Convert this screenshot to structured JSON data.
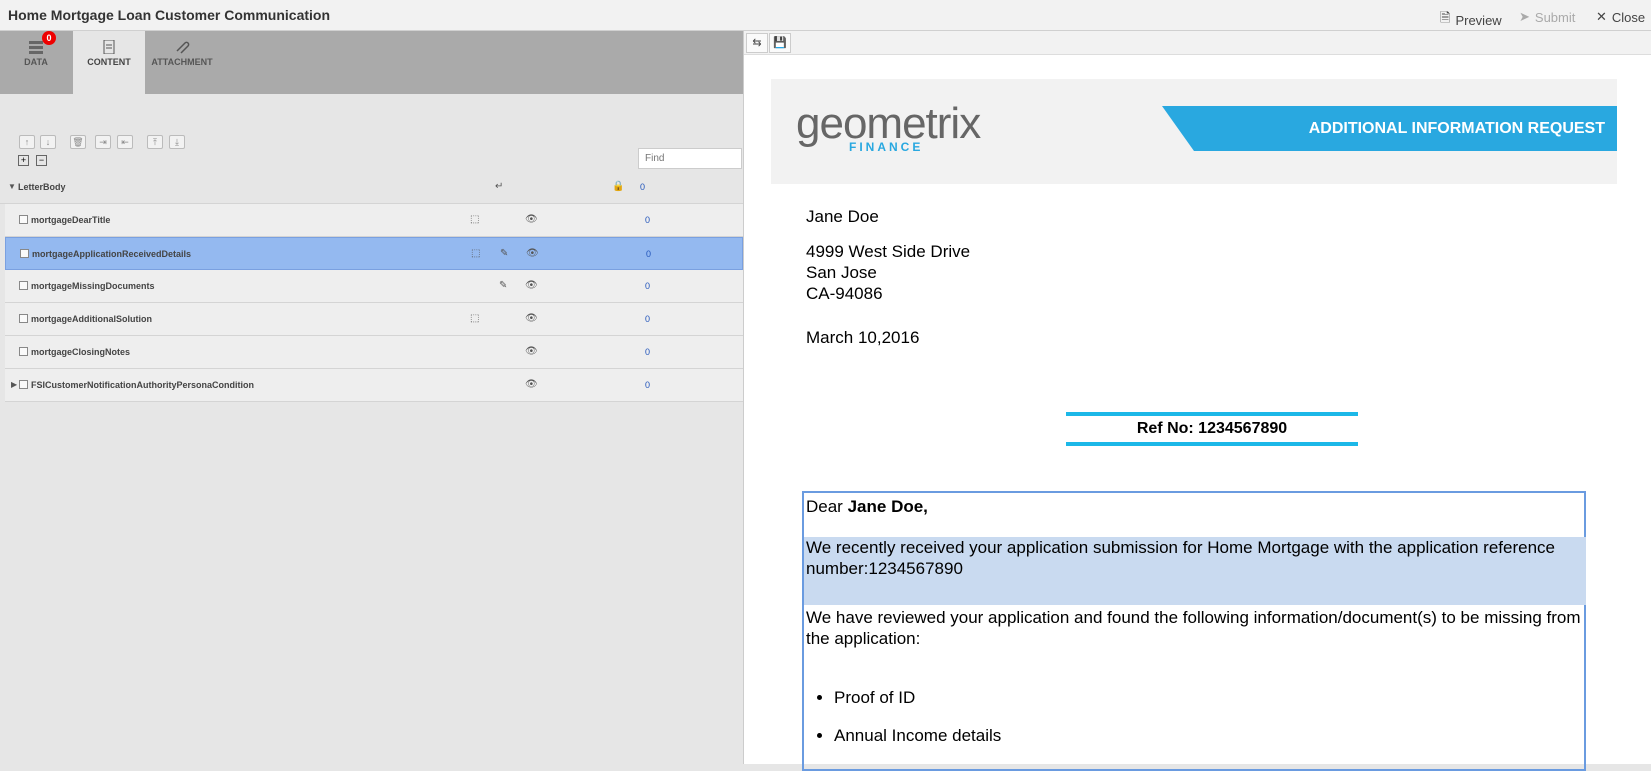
{
  "app": {
    "title": "Home Mortgage Loan Customer Communication",
    "actions": {
      "preview": "Preview",
      "submit": "Submit",
      "close": "Close"
    }
  },
  "tabs": [
    {
      "label": "DATA",
      "badge": "0"
    },
    {
      "label": "CONTENT"
    },
    {
      "label": "ATTACHMENT"
    }
  ],
  "find": {
    "placeholder": "Find"
  },
  "tree": {
    "group": {
      "label": "LetterBody",
      "count": "0"
    },
    "rows": [
      {
        "label": "mortgageDearTitle",
        "count": "0"
      },
      {
        "label": "mortgageApplicationReceivedDetails",
        "count": "0"
      },
      {
        "label": "mortgageMissingDocuments",
        "count": "0"
      },
      {
        "label": "mortgageAdditionalSolution",
        "count": "0"
      },
      {
        "label": "mortgageClosingNotes",
        "count": "0"
      }
    ],
    "condition": {
      "label": "FSICustomerNotificationAuthorityPersonaCondition",
      "count": "0"
    }
  },
  "letter": {
    "logo": "geometrix",
    "logo_sub": "FINANCE",
    "banner": "ADDITIONAL INFORMATION REQUEST",
    "name": "Jane Doe",
    "street": "4999 West Side Drive",
    "city": "San Jose",
    "state": "CA-94086",
    "date": "March 10,2016",
    "ref": "Ref No: 1234567890",
    "dear": "Dear",
    "dear_name": "Jane Doe,",
    "para1": "We recently received your application submission for Home Mortgage with the application reference number:1234567890",
    "para2": "We have reviewed your application and found the following information/document(s) to be missing from the application:",
    "items": [
      "Proof of ID",
      "Annual Income details"
    ]
  },
  "colors": {
    "accent": "#29a8e0",
    "selection": "#94b9f0",
    "badge": "#e00000"
  }
}
